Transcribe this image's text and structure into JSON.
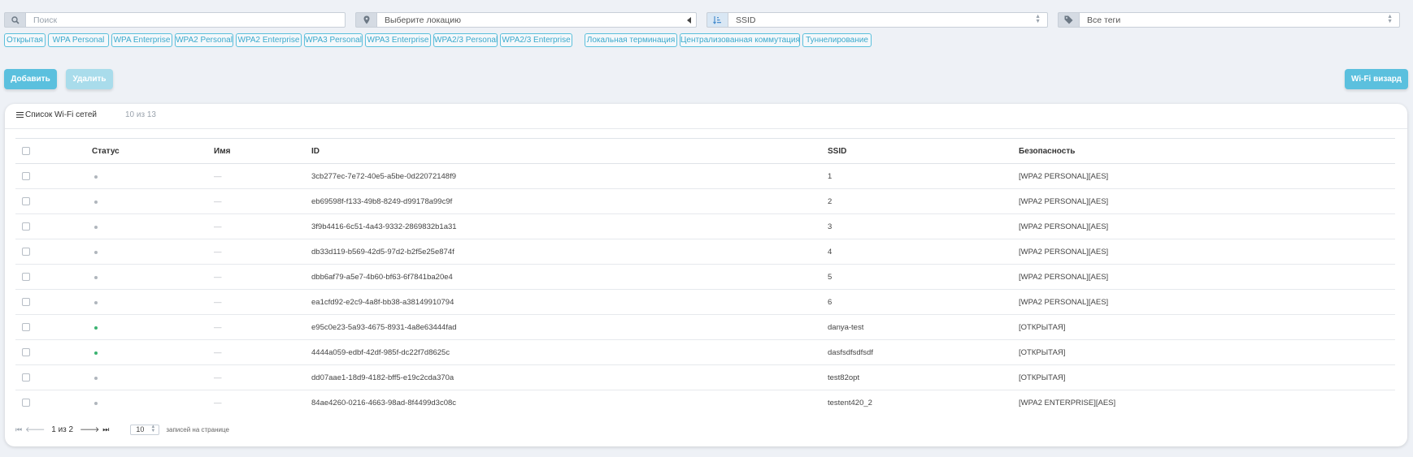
{
  "filters": {
    "search_placeholder": "Поиск",
    "location": "Выберите локацию",
    "sort": "SSID",
    "tags": "Все теги"
  },
  "security_chips": [
    "Открытая",
    "WPA Personal",
    "WPA Enterprise",
    "WPA2 Personal",
    "WPA2 Enterprise",
    "WPA3 Personal",
    "WPA3 Enterprise",
    "WPA2/3 Personal",
    "WPA2/3 Enterprise"
  ],
  "mode_chips": [
    "Локальная терминация",
    "Централизованная коммутация",
    "Туннелирование"
  ],
  "buttons": {
    "add": "Добавить",
    "delete": "Удалить",
    "wizard": "Wi-Fi визард"
  },
  "list": {
    "title": "Список Wi-Fi сетей",
    "count": "10 из 13",
    "columns": {
      "status": "Статус",
      "name": "Имя",
      "id": "ID",
      "ssid": "SSID",
      "security": "Безопасность"
    },
    "rows": [
      {
        "status": "inactive",
        "name": "—",
        "id": "3cb277ec-7e72-40e5-a5be-0d22072148f9",
        "ssid": "1",
        "security": "[WPA2 PERSONAL][AES]"
      },
      {
        "status": "inactive",
        "name": "—",
        "id": "eb69598f-f133-49b8-8249-d99178a99c9f",
        "ssid": "2",
        "security": "[WPA2 PERSONAL][AES]"
      },
      {
        "status": "inactive",
        "name": "—",
        "id": "3f9b4416-6c51-4a43-9332-2869832b1a31",
        "ssid": "3",
        "security": "[WPA2 PERSONAL][AES]"
      },
      {
        "status": "inactive",
        "name": "—",
        "id": "db33d119-b569-42d5-97d2-b2f5e25e874f",
        "ssid": "4",
        "security": "[WPA2 PERSONAL][AES]"
      },
      {
        "status": "inactive",
        "name": "—",
        "id": "dbb6af79-a5e7-4b60-bf63-6f7841ba20e4",
        "ssid": "5",
        "security": "[WPA2 PERSONAL][AES]"
      },
      {
        "status": "inactive",
        "name": "—",
        "id": "ea1cfd92-e2c9-4a8f-bb38-a38149910794",
        "ssid": "6",
        "security": "[WPA2 PERSONAL][AES]"
      },
      {
        "status": "active",
        "name": "—",
        "id": "e95c0e23-5a93-4675-8931-4a8e63444fad",
        "ssid": "danya-test",
        "security": "[ОТКРЫТАЯ]"
      },
      {
        "status": "active",
        "name": "—",
        "id": "4444a059-edbf-42df-985f-dc22f7d8625c",
        "ssid": "dasfsdfsdfsdf",
        "security": "[ОТКРЫТАЯ]"
      },
      {
        "status": "inactive",
        "name": "—",
        "id": "dd07aae1-18d9-4182-bff5-e19c2cda370a",
        "ssid": "test82opt",
        "security": "[ОТКРЫТАЯ]"
      },
      {
        "status": "inactive",
        "name": "—",
        "id": "84ae4260-0216-4663-98ad-8f4499d3c08c",
        "ssid": "testent420_2",
        "security": "[WPA2 ENTERPRISE][AES]"
      }
    ]
  },
  "pagination": {
    "page": "1 из 2",
    "per_page": "10",
    "per_page_label": "записей на странице"
  },
  "colors": {
    "accent": "#5bc0de",
    "active": "#3cb371",
    "inactive": "#b0b6bd"
  }
}
